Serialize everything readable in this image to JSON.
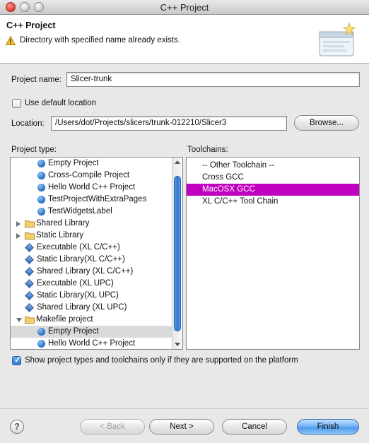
{
  "window": {
    "title": "C++ Project"
  },
  "banner": {
    "title": "C++ Project",
    "message": "Directory with specified name already exists."
  },
  "form": {
    "project_name_label": "Project name:",
    "project_name_value": "Slicer-trunk",
    "use_default_location_label": "Use default location",
    "use_default_location_checked": false,
    "location_label": "Location:",
    "location_value": "/Users/dot/Projects/slicers/trunk-012210/Slicer3",
    "browse_label": "Browse..."
  },
  "project_type": {
    "label": "Project type:",
    "items": [
      {
        "label": "Empty Project",
        "icon": "project-icon",
        "indent": 1
      },
      {
        "label": "Cross-Compile Project",
        "icon": "project-icon",
        "indent": 1
      },
      {
        "label": "Hello World C++ Project",
        "icon": "project-icon",
        "indent": 1
      },
      {
        "label": "TestProjectWithExtraPages",
        "icon": "project-icon",
        "indent": 1
      },
      {
        "label": "TestWidgetsLabel",
        "icon": "project-icon",
        "indent": 1
      },
      {
        "label": "Shared Library",
        "icon": "folder-icon",
        "indent": 0,
        "expander": "collapsed"
      },
      {
        "label": "Static Library",
        "icon": "folder-icon",
        "indent": 0,
        "expander": "collapsed"
      },
      {
        "label": "Executable (XL C/C++)",
        "icon": "diamond-icon",
        "indent": 0
      },
      {
        "label": "Static Library(XL C/C++)",
        "icon": "diamond-icon",
        "indent": 0
      },
      {
        "label": "Shared Library (XL C/C++)",
        "icon": "diamond-icon",
        "indent": 0
      },
      {
        "label": "Executable (XL UPC)",
        "icon": "diamond-icon",
        "indent": 0
      },
      {
        "label": "Static Library(XL UPC)",
        "icon": "diamond-icon",
        "indent": 0
      },
      {
        "label": "Shared Library (XL UPC)",
        "icon": "diamond-icon",
        "indent": 0
      },
      {
        "label": "Makefile project",
        "icon": "folder-icon",
        "indent": 0,
        "expander": "expanded"
      },
      {
        "label": "Empty Project",
        "icon": "project-icon",
        "indent": 1,
        "selected": true
      },
      {
        "label": "Hello World C++ Project",
        "icon": "project-icon",
        "indent": 1
      }
    ]
  },
  "toolchains": {
    "label": "Toolchains:",
    "items": [
      {
        "label": "-- Other Toolchain --"
      },
      {
        "label": "Cross GCC"
      },
      {
        "label": "MacOSX GCC",
        "selected": true
      },
      {
        "label": "XL C/C++ Tool Chain"
      }
    ]
  },
  "filter": {
    "label": "Show project types and toolchains only if they are supported on the platform",
    "checked": true
  },
  "buttons": {
    "back": "< Back",
    "next": "Next >",
    "cancel": "Cancel",
    "finish": "Finish"
  },
  "colors": {
    "selection_toolchain": "#c100bf",
    "selection_tree": "#dadada",
    "default_button": "#4d98e6"
  }
}
